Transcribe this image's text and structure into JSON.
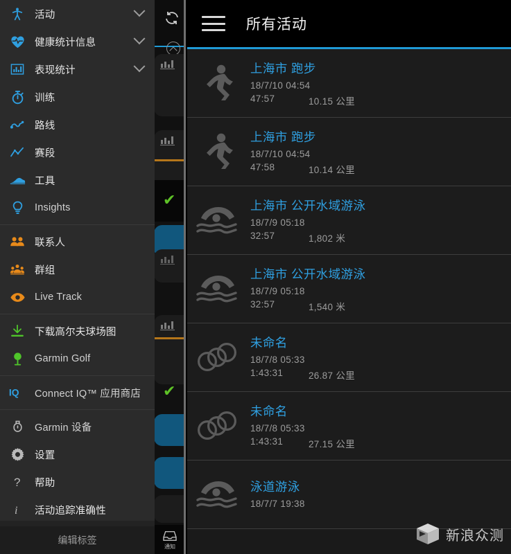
{
  "drawer": {
    "groups": [
      {
        "items": [
          {
            "icon": "activity-person-icon",
            "label": "活动",
            "expandable": true,
            "color": "#2f9fe0"
          },
          {
            "icon": "heart-health-icon",
            "label": "健康统计信息",
            "expandable": true,
            "color": "#2f9fe0"
          },
          {
            "icon": "performance-chart-icon",
            "label": "表现统计",
            "expandable": true,
            "color": "#2f9fe0"
          },
          {
            "icon": "stopwatch-training-icon",
            "label": "训练",
            "expandable": false,
            "color": "#2f9fe0"
          },
          {
            "icon": "route-icon",
            "label": "路线",
            "expandable": false,
            "color": "#2f9fe0"
          },
          {
            "icon": "segments-zigzag-icon",
            "label": "赛段",
            "expandable": false,
            "color": "#2f9fe0"
          },
          {
            "icon": "gear-shoe-icon",
            "label": "工具",
            "expandable": false,
            "color": "#2f9fe0"
          },
          {
            "icon": "lightbulb-insights-icon",
            "label": "Insights",
            "expandable": false,
            "color": "#2f9fe0"
          }
        ]
      },
      {
        "items": [
          {
            "icon": "contacts-people-icon",
            "label": "联系人",
            "expandable": false,
            "color": "#e88a1a"
          },
          {
            "icon": "groups-icon",
            "label": "群组",
            "expandable": false,
            "color": "#e88a1a"
          },
          {
            "icon": "live-track-eye-icon",
            "label": "Live Track",
            "expandable": false,
            "color": "#e88a1a"
          }
        ]
      },
      {
        "items": [
          {
            "icon": "download-golf-course-icon",
            "label": "下载高尔夫球场图",
            "expandable": false,
            "color": "#4fc52a"
          },
          {
            "icon": "golf-ball-tee-icon",
            "label": "Garmin Golf",
            "expandable": false,
            "color": "#4fc52a"
          }
        ]
      },
      {
        "items": [
          {
            "icon": "connect-iq-icon",
            "label": "Connect IQ™ 应用商店",
            "expandable": false,
            "color": "#2f9fe0"
          }
        ]
      },
      {
        "items": [
          {
            "icon": "garmin-device-watch-icon",
            "label": "Garmin 设备",
            "expandable": false,
            "color": "#b9b9b9"
          },
          {
            "icon": "gear-settings-icon",
            "label": "设置",
            "expandable": false,
            "color": "#b9b9b9"
          },
          {
            "icon": "help-question-icon",
            "label": "帮助",
            "expandable": false,
            "color": "#b9b9b9"
          },
          {
            "icon": "info-italic-icon",
            "label": "活动追踪准确性",
            "expandable": false,
            "color": "#b9b9b9"
          }
        ]
      }
    ],
    "footer": {
      "label": "编辑标签"
    }
  },
  "background": {
    "notification_label": "通知",
    "icons": {
      "sync": "sync-refresh-icon",
      "collapse": "chevron-up-circle-icon",
      "notification": "notification-inbox-icon",
      "check": "✔"
    }
  },
  "panel": {
    "menu_icon": "hamburger-menu-icon",
    "title": "所有活动",
    "accent_color": "#1f9ad6",
    "activities": [
      {
        "icon": "running-icon",
        "title": "上海市 跑步",
        "date": "18/7/10 04:54",
        "duration": "47:57",
        "distance": "10.15 公里"
      },
      {
        "icon": "running-icon",
        "title": "上海市 跑步",
        "date": "18/7/10 04:54",
        "duration": "47:58",
        "distance": "10.14 公里"
      },
      {
        "icon": "open-water-swim-icon",
        "title": "上海市 公开水域游泳",
        "date": "18/7/9 05:18",
        "duration": "32:57",
        "distance": "1,802 米"
      },
      {
        "icon": "open-water-swim-icon",
        "title": "上海市 公开水域游泳",
        "date": "18/7/9 05:18",
        "duration": "32:57",
        "distance": "1,540 米"
      },
      {
        "icon": "multisport-rings-icon",
        "title": "未命名",
        "date": "18/7/8 05:33",
        "duration": "1:43:31",
        "distance": "26.87 公里"
      },
      {
        "icon": "multisport-rings-icon",
        "title": "未命名",
        "date": "18/7/8 05:33",
        "duration": "1:43:31",
        "distance": "27.15 公里"
      },
      {
        "icon": "pool-swim-icon",
        "title": "泳道游泳",
        "date": "18/7/7 19:38",
        "duration": "",
        "distance": ""
      }
    ]
  },
  "watermark": {
    "text": "新浪众测",
    "icon": "cube-logo-icon"
  }
}
